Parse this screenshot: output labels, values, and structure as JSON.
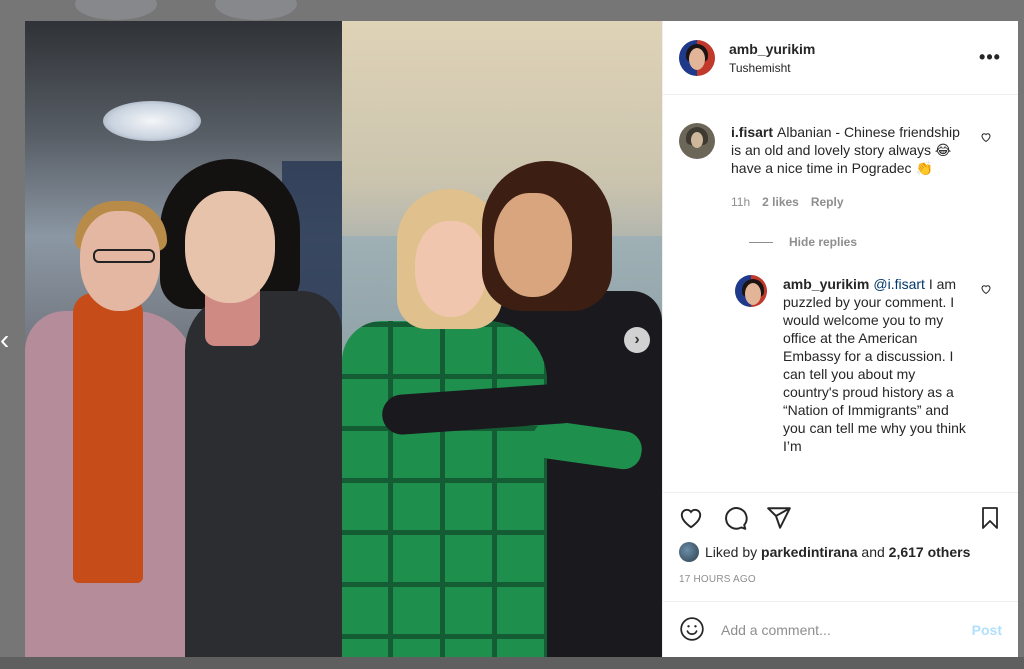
{
  "post": {
    "username": "amb_yurikim",
    "location": "Tushemisht",
    "more_icon": "more-horizontal-icon"
  },
  "comments": [
    {
      "username": "i.fisart",
      "text": "Albanian - Chinese friendship is an old and lovely story always 😂 have a nice time in Pogradec 👏",
      "time": "11h",
      "likes": "2 likes",
      "reply_label": "Reply"
    }
  ],
  "hide_replies_label": "Hide replies",
  "reply": {
    "username": "amb_yurikim",
    "mention": "@i.fisart",
    "text": "I am puzzled by your comment. I would welcome you to my office at the American Embassy for a discussion. I can tell you about my country's proud history as a “Nation of Immigrants” and you can tell me why you think I’m"
  },
  "likes": {
    "prefix": "Liked by",
    "user": "parkedintirana",
    "and": "and",
    "others": "2,617 others"
  },
  "timestamp": "17 HOURS AGO",
  "add_comment": {
    "placeholder": "Add a comment...",
    "post_label": "Post"
  },
  "carousel": {
    "prev_glyph": "‹",
    "next_glyph": "›"
  },
  "colors": {
    "link": "#00376b",
    "muted": "#8e8e8e",
    "post_disabled": "#b2dffc"
  }
}
